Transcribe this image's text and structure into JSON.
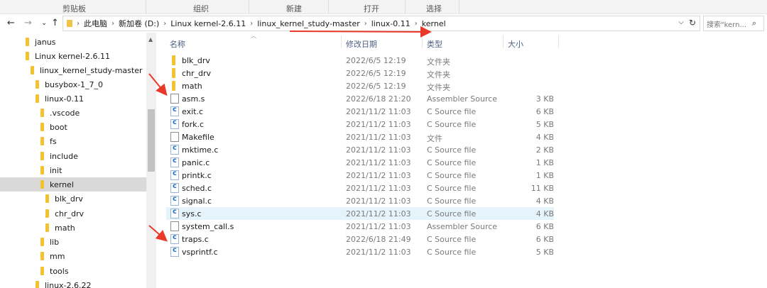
{
  "ribbon": {
    "groups": [
      "剪贴板",
      "组织",
      "新建",
      "打开",
      "选择"
    ]
  },
  "address": {
    "crumbs": [
      "此电脑",
      "新加卷 (D:)",
      "Linux kernel-2.6.11",
      "linux_kernel_study-master",
      "linux-0.11",
      "kernel"
    ],
    "search_placeholder": "搜索\"kern...",
    "chevron": "›",
    "dropdown": "⌵",
    "refresh": "↻"
  },
  "nav": {
    "back": "←",
    "forward": "→",
    "history": "⌄",
    "up": "↑"
  },
  "tree": [
    {
      "label": "janus"
    },
    {
      "label": "Linux kernel-2.6.11"
    },
    {
      "label": "linux_kernel_study-master"
    },
    {
      "label": "busybox-1_7_0"
    },
    {
      "label": "linux-0.11"
    },
    {
      "label": ".vscode"
    },
    {
      "label": "boot"
    },
    {
      "label": "fs"
    },
    {
      "label": "include"
    },
    {
      "label": "init"
    },
    {
      "label": "kernel",
      "selected": true
    },
    {
      "label": "blk_drv"
    },
    {
      "label": "chr_drv"
    },
    {
      "label": "math"
    },
    {
      "label": "lib"
    },
    {
      "label": "mm"
    },
    {
      "label": "tools"
    },
    {
      "label": "linux-2.6.22"
    }
  ],
  "columns": {
    "name": "名称",
    "date": "修改日期",
    "type": "类型",
    "size": "大小"
  },
  "files": [
    {
      "name": "blk_drv",
      "date": "2022/6/5 12:19",
      "type": "文件夹",
      "size": "",
      "icon": "folder-icon"
    },
    {
      "name": "chr_drv",
      "date": "2022/6/5 12:19",
      "type": "文件夹",
      "size": "",
      "icon": "folder-icon"
    },
    {
      "name": "math",
      "date": "2022/6/5 12:19",
      "type": "文件夹",
      "size": "",
      "icon": "folder-icon"
    },
    {
      "name": "asm.s",
      "date": "2022/6/18 21:20",
      "type": "Assembler Source",
      "size": "3 KB",
      "icon": "file-icon"
    },
    {
      "name": "exit.c",
      "date": "2021/11/2 11:03",
      "type": "C Source file",
      "size": "6 KB",
      "icon": "c-source-icon"
    },
    {
      "name": "fork.c",
      "date": "2021/11/2 11:03",
      "type": "C Source file",
      "size": "5 KB",
      "icon": "c-source-icon"
    },
    {
      "name": "Makefile",
      "date": "2021/11/2 11:03",
      "type": "文件",
      "size": "4 KB",
      "icon": "file-icon"
    },
    {
      "name": "mktime.c",
      "date": "2021/11/2 11:03",
      "type": "C Source file",
      "size": "2 KB",
      "icon": "c-source-icon"
    },
    {
      "name": "panic.c",
      "date": "2021/11/2 11:03",
      "type": "C Source file",
      "size": "1 KB",
      "icon": "c-source-icon"
    },
    {
      "name": "printk.c",
      "date": "2021/11/2 11:03",
      "type": "C Source file",
      "size": "1 KB",
      "icon": "c-source-icon"
    },
    {
      "name": "sched.c",
      "date": "2021/11/2 11:03",
      "type": "C Source file",
      "size": "11 KB",
      "icon": "c-source-icon"
    },
    {
      "name": "signal.c",
      "date": "2021/11/2 11:03",
      "type": "C Source file",
      "size": "4 KB",
      "icon": "c-source-icon"
    },
    {
      "name": "sys.c",
      "date": "2021/11/2 11:03",
      "type": "C Source file",
      "size": "4 KB",
      "icon": "c-source-icon",
      "highlighted": true
    },
    {
      "name": "system_call.s",
      "date": "2021/11/2 11:03",
      "type": "Assembler Source",
      "size": "6 KB",
      "icon": "file-icon"
    },
    {
      "name": "traps.c",
      "date": "2022/6/18 21:49",
      "type": "C Source file",
      "size": "6 KB",
      "icon": "c-source-icon"
    },
    {
      "name": "vsprintf.c",
      "date": "2021/11/2 11:03",
      "type": "C Source file",
      "size": "5 KB",
      "icon": "c-source-icon"
    }
  ],
  "colors": {
    "accent_arrow": "#e8392b",
    "selection": "#e5f3fb",
    "folder": "#f2c230"
  }
}
